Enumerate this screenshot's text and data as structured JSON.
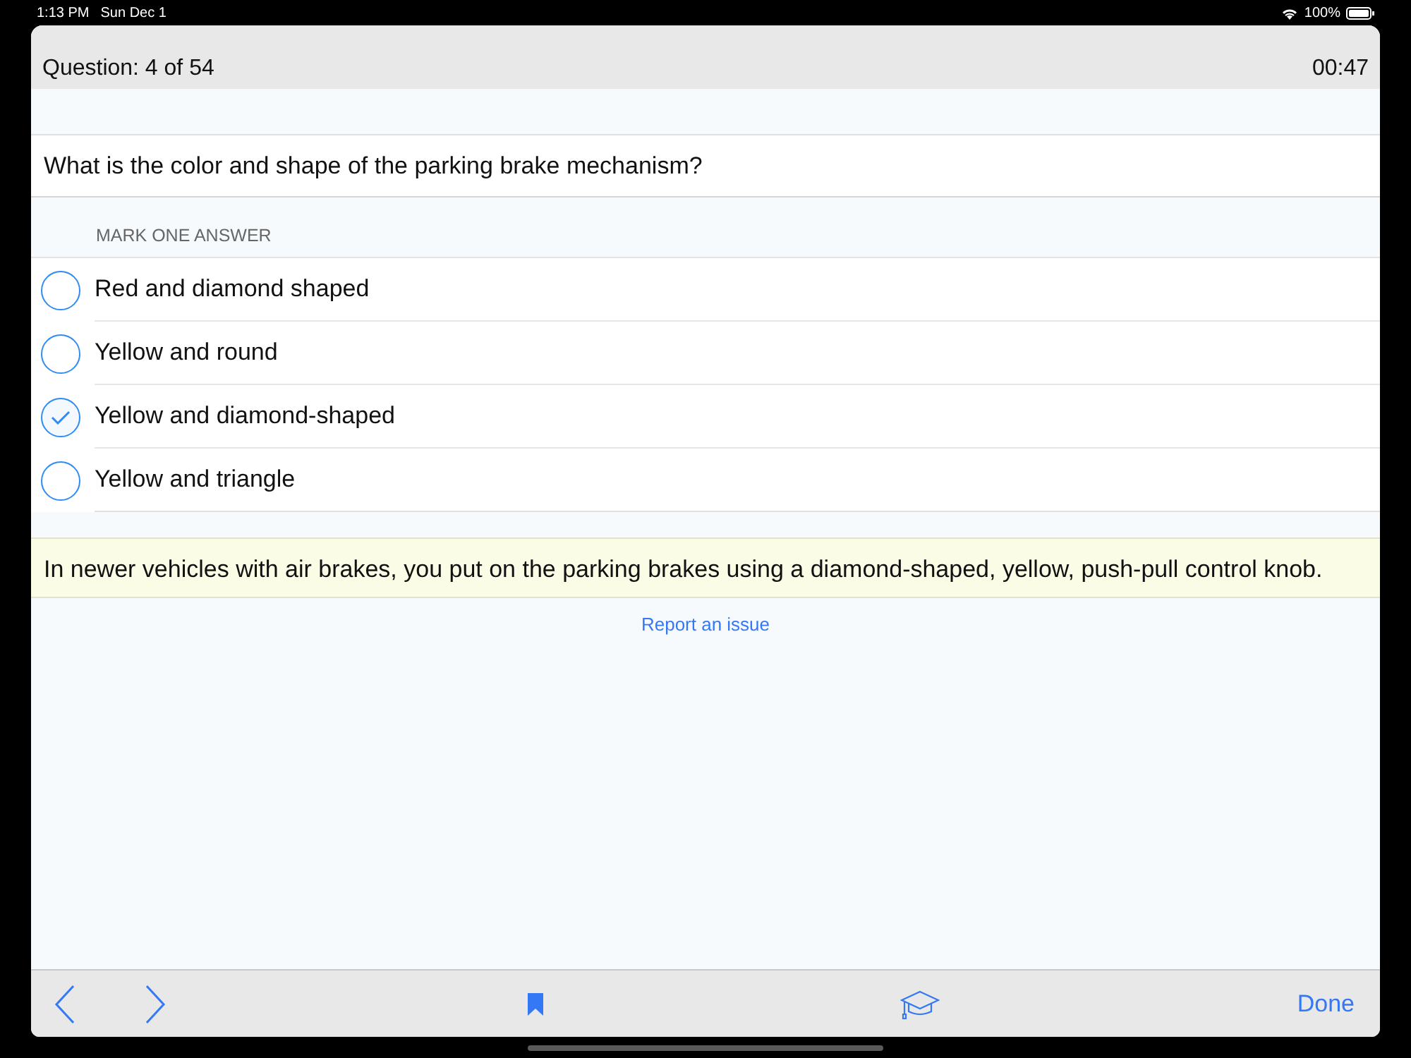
{
  "status_bar": {
    "time": "1:13 PM",
    "date": "Sun Dec 1",
    "battery": "100%"
  },
  "header": {
    "progress": "Question: 4 of 54",
    "timer": "00:47"
  },
  "question": "What is the color and shape of the parking brake mechanism?",
  "answers_heading": "MARK ONE ANSWER",
  "answers": [
    {
      "label": "Red and diamond shaped",
      "selected": false
    },
    {
      "label": "Yellow and round",
      "selected": false
    },
    {
      "label": "Yellow and diamond-shaped",
      "selected": true
    },
    {
      "label": "Yellow and triangle",
      "selected": false
    }
  ],
  "explanation": "In newer vehicles with air brakes, you put on the parking brakes using a diamond-shaped, yellow, push-pull control knob.",
  "report_link": "Report an issue",
  "toolbar": {
    "done": "Done"
  }
}
